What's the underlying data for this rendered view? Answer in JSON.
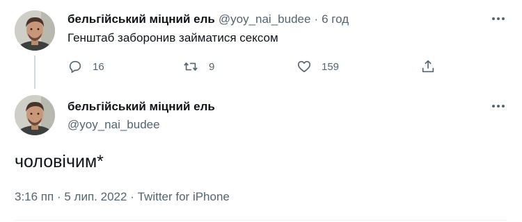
{
  "reply_tweet": {
    "display_name": "бельгійський міцний ель",
    "handle": "@yoy_nai_budee",
    "separator": "·",
    "time_ago": "6 год",
    "text": "Генштаб заборонив займатися сексом",
    "reply_count": "16",
    "retweet_count": "9",
    "like_count": "159"
  },
  "main_tweet": {
    "display_name": "бельгійський міцний ель",
    "handle": "@yoy_nai_budee",
    "text": "чоловічим*",
    "time": "3:16 пп",
    "separator": "·",
    "date": "5 лип. 2022",
    "source": "Twitter for iPhone"
  },
  "icons": {
    "reply": "reply-icon",
    "retweet": "retweet-icon",
    "like": "heart-icon",
    "share": "share-icon",
    "more": "more-options-icon"
  },
  "colors": {
    "primary_text": "#0f1419",
    "secondary_text": "#536471",
    "thread_line": "#cfd9de",
    "divider": "#eff3f4",
    "background": "#ffffff"
  }
}
